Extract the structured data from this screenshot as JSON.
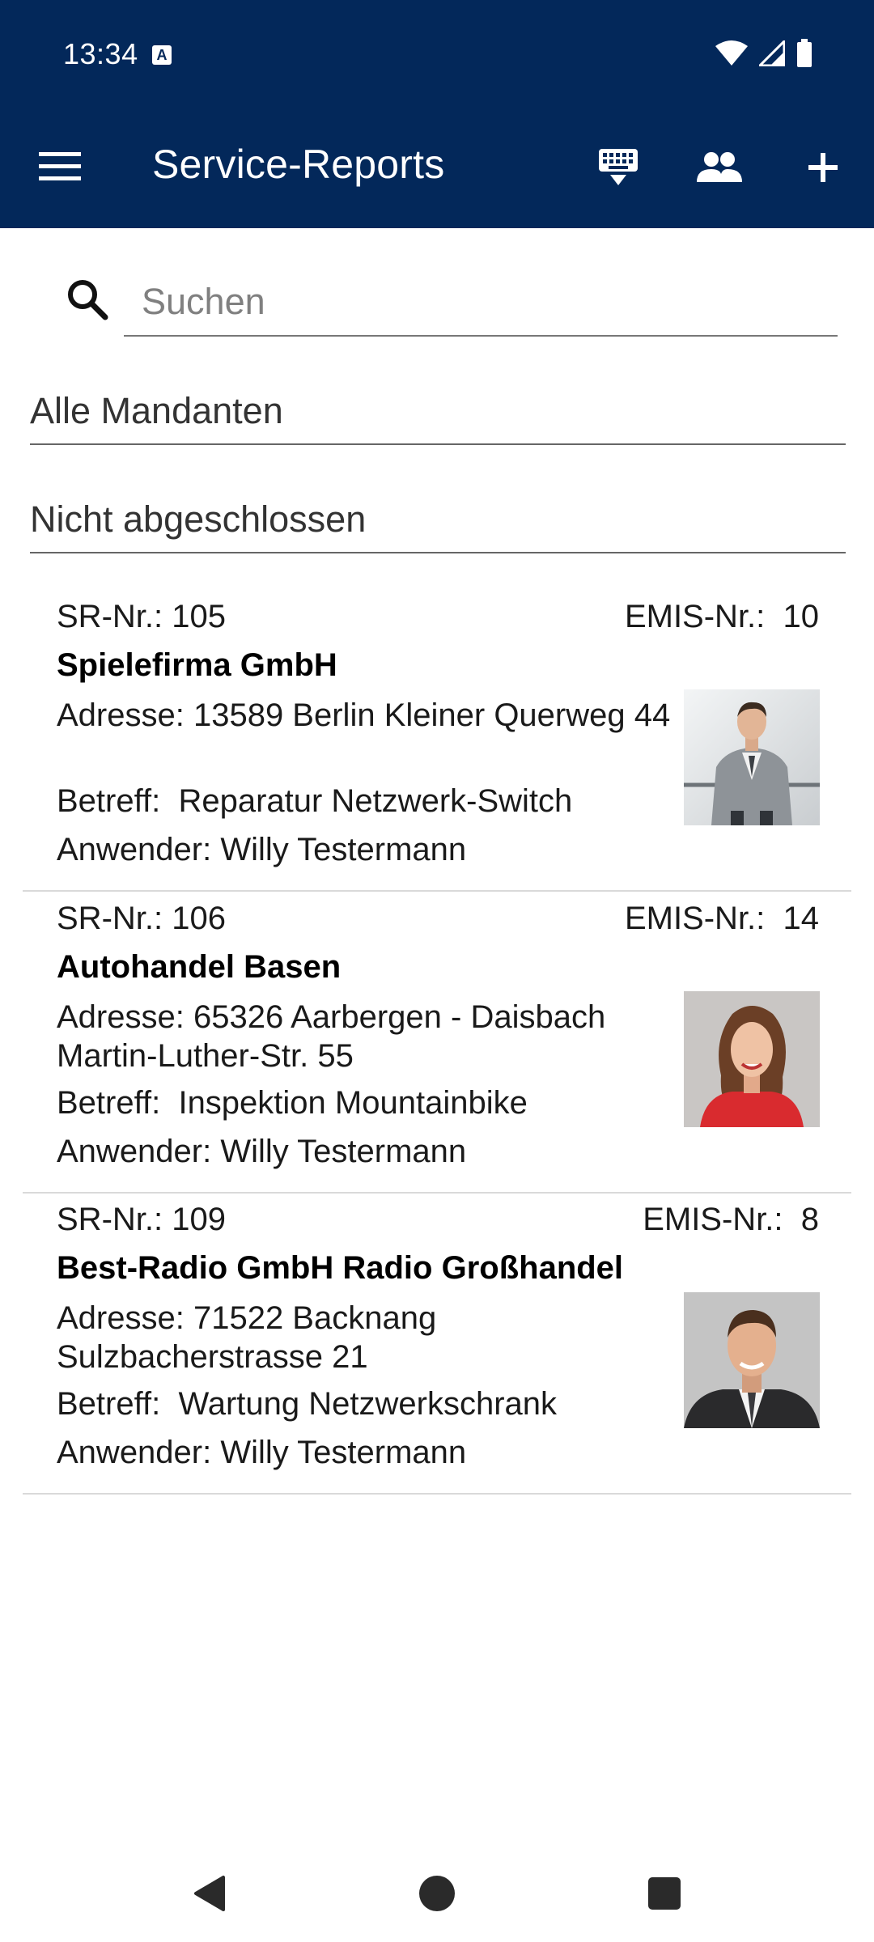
{
  "status_bar": {
    "time": "13:34",
    "notification_icon": "A"
  },
  "app_bar": {
    "title": "Service-Reports",
    "icons": [
      "menu-icon",
      "keyboard-icon",
      "people-icon",
      "plus-icon"
    ]
  },
  "search": {
    "placeholder": "Suchen",
    "value": ""
  },
  "filters": {
    "mandanten": "Alle Mandanten",
    "status": "Nicht abgeschlossen"
  },
  "reports": [
    {
      "sr": "SR-Nr.: 105",
      "emis": "EMIS-Nr.:  10",
      "company": "Spielefirma GmbH",
      "address": "Adresse: 13589 Berlin Kleiner Querweg 44",
      "subject": "Betreff:  Reparatur Netzwerk-Switch",
      "user": "Anwender: Willy Testermann",
      "photo": "man-in-grey-suit-photo"
    },
    {
      "sr": "SR-Nr.: 106",
      "emis": "EMIS-Nr.:  14",
      "company": "Autohandel Basen",
      "address": "Adresse: 65326 Aarbergen - Daisbach Martin-Luther-Str. 55",
      "subject": "Betreff:  Inspektion Mountainbike",
      "user": "Anwender: Willy Testermann",
      "photo": "woman-red-top-photo"
    },
    {
      "sr": "SR-Nr.: 109",
      "emis": "EMIS-Nr.:  8",
      "company": "Best-Radio GmbH Radio Großhandel",
      "address": "Adresse: 71522 Backnang Sulzbacherstrasse 21",
      "subject": "Betreff:  Wartung Netzwerkschrank",
      "user": "Anwender: Willy Testermann",
      "photo": "man-dark-suit-photo"
    }
  ],
  "colors": {
    "primary": "#03285a",
    "divider": "#d9d9d9",
    "text": "#1a1a1a"
  }
}
